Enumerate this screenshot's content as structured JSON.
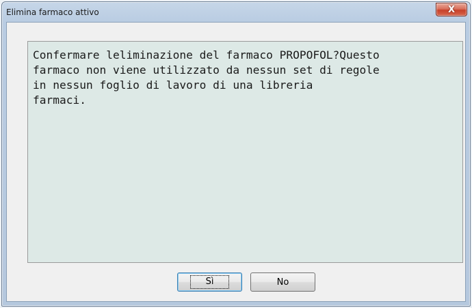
{
  "dialog": {
    "title": "Elimina farmaco attivo",
    "close_glyph": "X",
    "close_icon": "close-icon",
    "message": "Confermare leliminazione del farmaco PROPOFOL?Questo\nfarmaco non viene utilizzato da nessun set di regole\nin nessun foglio di lavoro di una libreria\nfarmaci.",
    "buttons": {
      "yes_label": "Sì",
      "no_label": "No"
    }
  },
  "colors": {
    "message_background": "#dde9e6",
    "close_button": "#c7412a",
    "window_frame": "#b9cce2"
  }
}
